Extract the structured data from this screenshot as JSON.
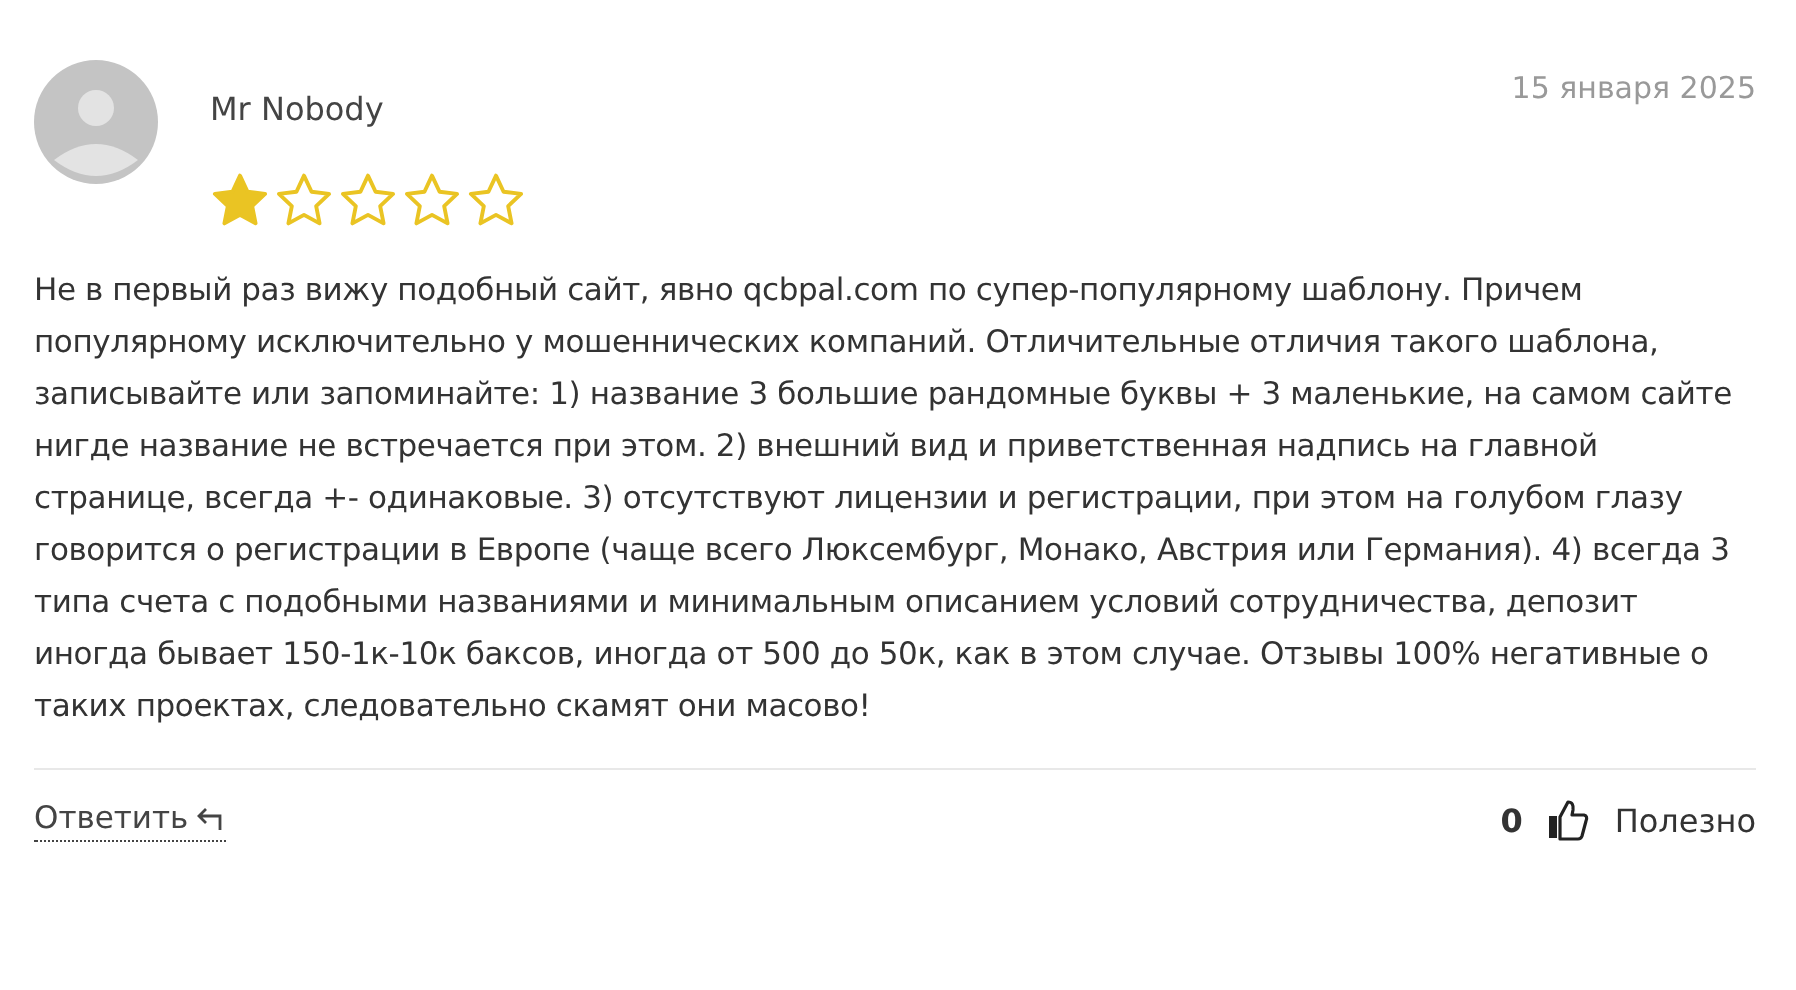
{
  "review": {
    "author": "Mr Nobody",
    "date": "15 января 2025",
    "stars": 1,
    "text": "Не в первый раз вижу подобный сайт, явно qcbpal.com по супер-популярному шаблону. Причем популярному исключительно у мошеннических компаний. Отличительные отличия такого шаблона, записывайте или запоминайте: 1) название 3 большие рандомные буквы + 3 маленькие, на самом сайте нигде название не встречается при этом. 2) внешний вид и приветственная надпись на главной странице, всегда +- одинаковые. 3) отсутствуют лицензии и регистрации, при этом на голубом глазу говорится о регистрации в Европе (чаще всего Люксембург, Монако, Австрия или Германия). 4) всегда 3 типа счета с подобными названиями и минимальным описанием условий сотрудничества, депозит иногда бывает 150-1к-10к баксов, иногда от 500 до 50к, как в этом случае. Отзывы 100% негативные о таких проектах, следовательно скамят они масово!",
    "reply_label": "Ответить",
    "helpful_count": "0",
    "helpful_label": "Полезно"
  }
}
